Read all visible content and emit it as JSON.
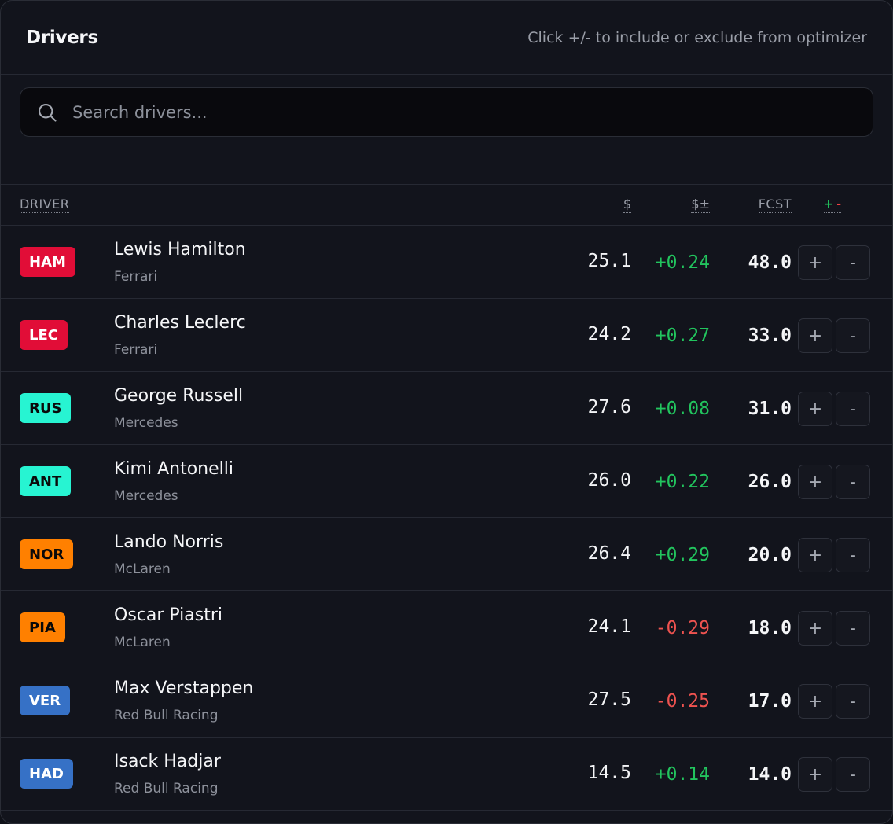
{
  "header": {
    "title": "Drivers",
    "subtitle": "Click +/- to include or exclude from optimizer"
  },
  "search": {
    "placeholder": "Search drivers...",
    "value": "",
    "icon": "search-icon"
  },
  "table": {
    "columns": {
      "driver": "DRIVER",
      "price": "$",
      "delta": "$±",
      "fcst": "FCST",
      "include": "+",
      "exclude": "-"
    },
    "rows": [
      {
        "code": "HAM",
        "name": "Lewis Hamilton",
        "team": "Ferrari",
        "price": "25.1",
        "delta": "+0.24",
        "fcst": "48.0",
        "badge_bg": "#e10d37",
        "badge_fg": "#ffffff"
      },
      {
        "code": "LEC",
        "name": "Charles Leclerc",
        "team": "Ferrari",
        "price": "24.2",
        "delta": "+0.27",
        "fcst": "33.0",
        "badge_bg": "#e10d37",
        "badge_fg": "#ffffff"
      },
      {
        "code": "RUS",
        "name": "George Russell",
        "team": "Mercedes",
        "price": "27.6",
        "delta": "+0.08",
        "fcst": "31.0",
        "badge_bg": "#27f4d2",
        "badge_fg": "#0a0a0a"
      },
      {
        "code": "ANT",
        "name": "Kimi Antonelli",
        "team": "Mercedes",
        "price": "26.0",
        "delta": "+0.22",
        "fcst": "26.0",
        "badge_bg": "#27f4d2",
        "badge_fg": "#0a0a0a"
      },
      {
        "code": "NOR",
        "name": "Lando Norris",
        "team": "McLaren",
        "price": "26.4",
        "delta": "+0.29",
        "fcst": "20.0",
        "badge_bg": "#ff8000",
        "badge_fg": "#0a0a0a"
      },
      {
        "code": "PIA",
        "name": "Oscar Piastri",
        "team": "McLaren",
        "price": "24.1",
        "delta": "-0.29",
        "fcst": "18.0",
        "badge_bg": "#ff8000",
        "badge_fg": "#0a0a0a"
      },
      {
        "code": "VER",
        "name": "Max Verstappen",
        "team": "Red Bull Racing",
        "price": "27.5",
        "delta": "-0.25",
        "fcst": "17.0",
        "badge_bg": "#3671c6",
        "badge_fg": "#ffffff"
      },
      {
        "code": "HAD",
        "name": "Isack Hadjar",
        "team": "Red Bull Racing",
        "price": "14.5",
        "delta": "+0.14",
        "fcst": "14.0",
        "badge_bg": "#3671c6",
        "badge_fg": "#ffffff"
      }
    ],
    "include_label": "+",
    "exclude_label": "-"
  },
  "colors": {
    "positive": "#22c55e",
    "negative": "#ef5350"
  }
}
